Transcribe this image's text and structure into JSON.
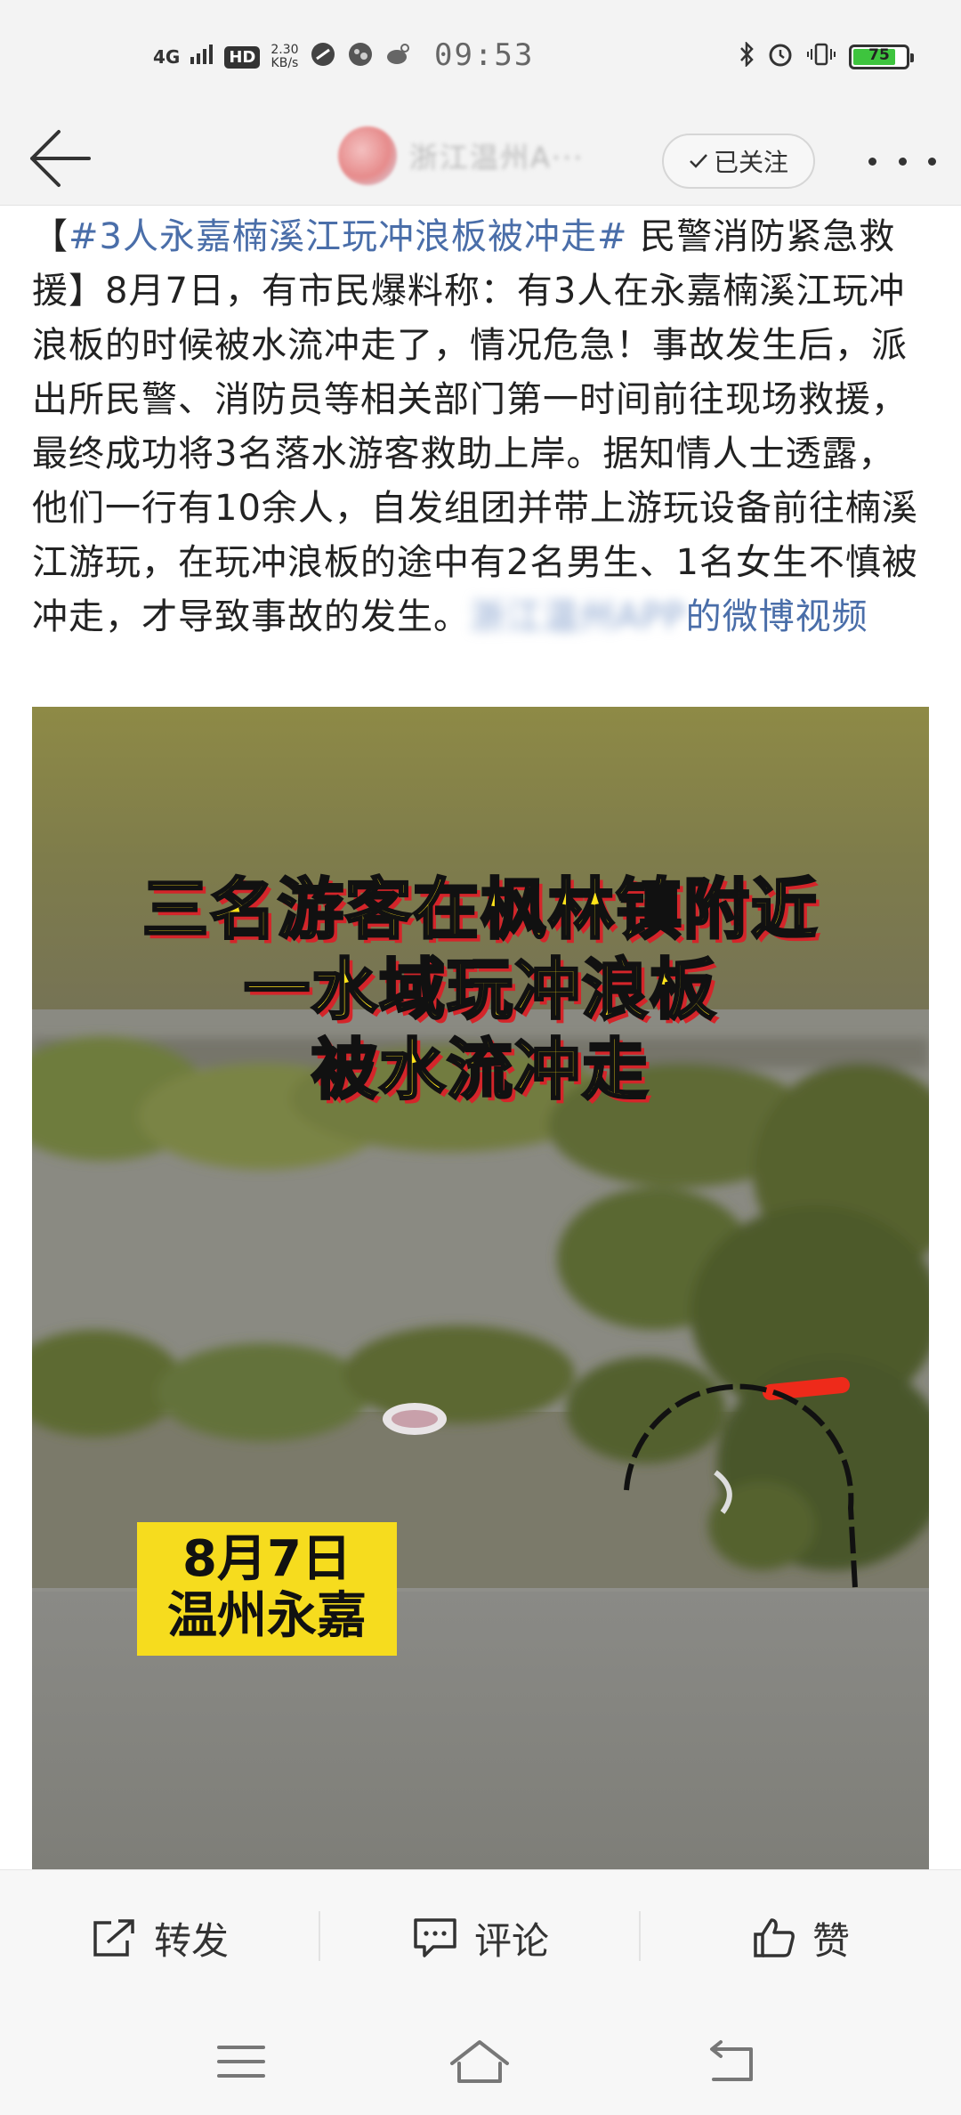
{
  "status_bar": {
    "network": "4G",
    "hd": "HD",
    "speed_value": "2.30",
    "speed_unit": "KB/s",
    "time": "09:53",
    "battery": "75"
  },
  "header": {
    "account_name": "浙江温州A···",
    "follow_label": "已关注"
  },
  "post": {
    "open_bracket": "【",
    "topic": "#3人永嘉楠溪江玩冲浪板被冲走#",
    "body": " 民警消防紧急救援】8月7日，有市民爆料称：有3人在永嘉楠溪江玩冲浪板的时候被水流冲走了，情况危急！事故发生后，派出所民警、消防员等相关部门第一时间前往现场救援，最终成功将3名落水游客救助上岸。据知情人士透露，他们一行有10余人，自发组团并带上游玩设备前往楠溪江游玩，在玩冲浪板的途中有2名男生、1名女生不慎被冲走，才导致事故的发生。",
    "author_link": "浙江温州APP",
    "video_link_suffix": "的微博视频"
  },
  "video": {
    "caption_line1": "三名游客在枫林镇附近",
    "caption_line2": "一水域玩冲浪板",
    "caption_line3": "被水流冲走",
    "date": "8月7日",
    "place": "温州永嘉"
  },
  "actions": {
    "repost": "转发",
    "comment": "评论",
    "like": "赞"
  },
  "colors": {
    "link": "#4a6ea9",
    "caption_yellow": "#ffe31a",
    "caption_shadow": "#d4252a",
    "date_box": "#f6dc1e",
    "battery_green": "#3ec43e"
  }
}
